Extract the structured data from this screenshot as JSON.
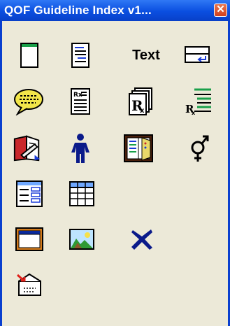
{
  "window": {
    "title": "QOF Guideline Index v1...",
    "close_label": "✕"
  },
  "toolbox": {
    "text_tool_label": "Text",
    "tools": [
      [
        "blank-page",
        "formatted-page",
        "text",
        "input-box"
      ],
      [
        "speech-bubble",
        "prescription-page",
        "prescription-stack",
        "prescription-list"
      ],
      [
        "edit-document",
        "person",
        "open-book",
        "gender-symbol"
      ],
      [
        "form-layout",
        "table-grid"
      ],
      [
        "picture-frame",
        "image"
      ],
      [
        "delete-cross"
      ],
      [
        "mail-envelope"
      ]
    ]
  }
}
